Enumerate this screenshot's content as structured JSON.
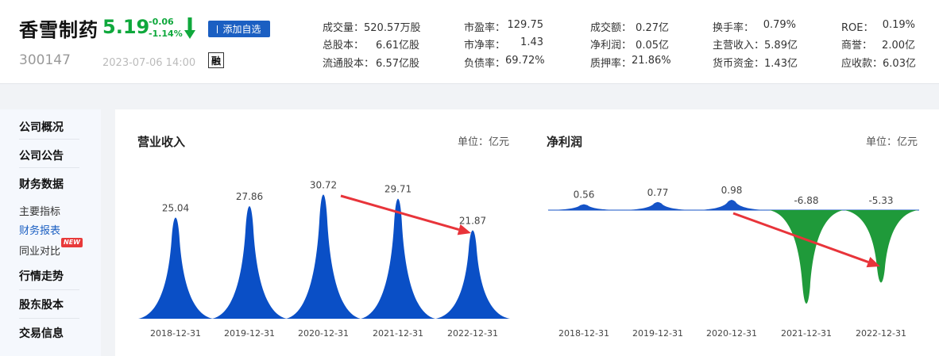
{
  "header": {
    "name": "香雪制药",
    "code": "300147",
    "price": "5.19",
    "change": "-0.06",
    "change_pct": "-1.14%",
    "add_label": "添加自选",
    "time": "2023-07-06 14:00",
    "rong_label": "融"
  },
  "metrics": [
    [
      {
        "label": "成交量：",
        "value": "520.57万股"
      },
      {
        "label": "总股本：",
        "value": "6.61亿股"
      },
      {
        "label": "流通股本：",
        "value": "6.57亿股"
      }
    ],
    [
      {
        "label": "市盈率：",
        "value": "129.75"
      },
      {
        "label": "市净率：",
        "value": "1.43"
      },
      {
        "label": "负债率：",
        "value": "69.72%"
      }
    ],
    [
      {
        "label": "成交额：",
        "value": "0.27亿"
      },
      {
        "label": "净利润：",
        "value": "0.05亿"
      },
      {
        "label": "质押率：",
        "value": "21.86%"
      }
    ],
    [
      {
        "label": "换手率：",
        "value": "0.79%"
      },
      {
        "label": "主营收入：",
        "value": "5.89亿"
      },
      {
        "label": "货币资金：",
        "value": "1.43亿"
      }
    ],
    [
      {
        "label": "ROE：",
        "value": "0.19%"
      },
      {
        "label": "商誉：",
        "value": "2.00亿"
      },
      {
        "label": "应收款：",
        "value": "6.03亿"
      }
    ]
  ],
  "sidebar": {
    "items": [
      "公司概况",
      "公司公告",
      "财务数据",
      "行情走势",
      "股东股本",
      "交易信息"
    ],
    "subs": [
      "主要指标",
      "财务报表",
      "同业对比"
    ],
    "new_badge": "NEW"
  },
  "colors": {
    "accent": "#1b5fc2",
    "down": "#0fa83c",
    "revenue": "#0a4fc6",
    "profit_pos": "#1553c7",
    "profit_neg": "#1f9a3a",
    "annotation": "#e8343a"
  },
  "chart_data": [
    {
      "type": "area",
      "title": "营业收入",
      "unit": "单位：亿元",
      "categories": [
        "2018-12-31",
        "2019-12-31",
        "2020-12-31",
        "2021-12-31",
        "2022-12-31"
      ],
      "values": [
        25.04,
        27.86,
        30.72,
        29.71,
        21.87
      ],
      "labels": [
        "25.04",
        "27.86",
        "30.72",
        "29.71",
        "21.87"
      ],
      "ylim": [
        0,
        32
      ],
      "annotation": "arrow from 2020 peak down to 2022 peak"
    },
    {
      "type": "area",
      "title": "净利润",
      "unit": "单位：亿元",
      "categories": [
        "2018-12-31",
        "2019-12-31",
        "2020-12-31",
        "2021-12-31",
        "2022-12-31"
      ],
      "values": [
        0.56,
        0.77,
        0.98,
        -6.88,
        -5.33
      ],
      "labels": [
        "0.56",
        "0.77",
        "0.98",
        "-6.88",
        "-5.33"
      ],
      "annotation": "arrow from 2020 peak down to 2022 trough"
    }
  ]
}
